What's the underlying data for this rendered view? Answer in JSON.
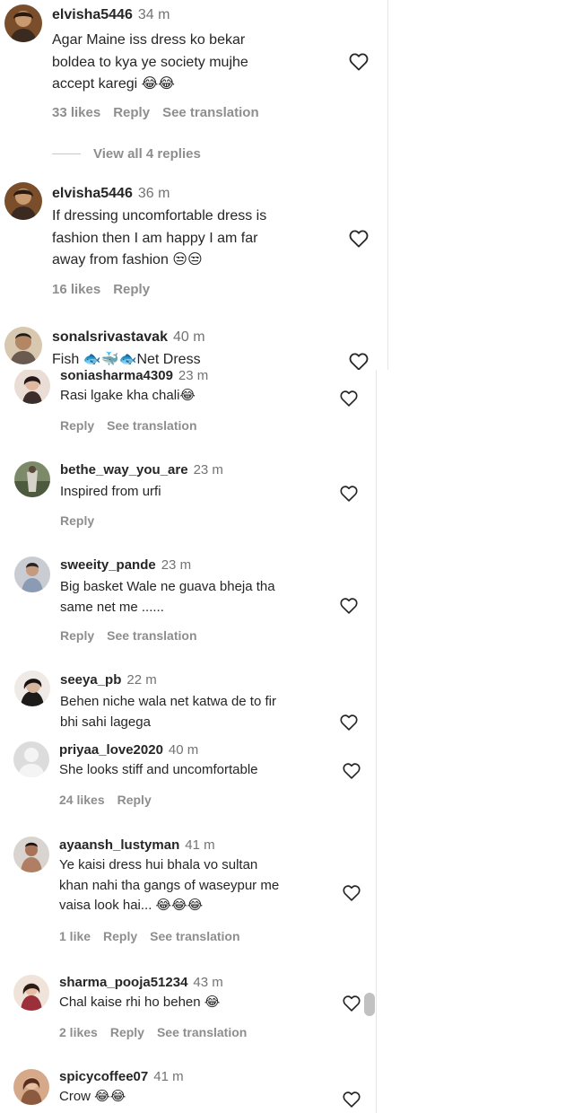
{
  "panel_a": {
    "comments": [
      {
        "username": "elvisha5446",
        "time": "34 m",
        "lines": [
          "Agar Maine iss dress ko bekar",
          "boldea to kya ye society mujhe",
          "accept karegi 😂😂"
        ],
        "likes": "33 likes",
        "reply": "Reply",
        "see_translation": "See translation"
      },
      {
        "username": "elvisha5446",
        "time": "36 m",
        "lines": [
          "If dressing uncomfortable dress is",
          "fashion then I am happy I am far",
          "away from fashion 😒😒"
        ],
        "likes": "16 likes",
        "reply": "Reply"
      },
      {
        "username": "sonalsrivastavak",
        "time": "40 m",
        "lines": [
          "Fish 🐟🐳🐟Net Dress"
        ]
      }
    ],
    "view_replies": "View all 4 replies"
  },
  "panel_b": {
    "comments": [
      {
        "username": "soniasharma4309",
        "time": "23 m",
        "lines": [
          "Rasi lgake kha chali😂"
        ],
        "reply": "Reply",
        "see_translation": "See translation"
      },
      {
        "username": "bethe_way_you_are",
        "time": "23 m",
        "lines": [
          "Inspired from urfi"
        ],
        "reply": "Reply"
      },
      {
        "username": "sweeity_pande",
        "time": "23 m",
        "lines": [
          "Big basket Wale ne guava bheja tha",
          "same net me ......"
        ],
        "reply": "Reply",
        "see_translation": "See translation"
      },
      {
        "username": "seeya_pb",
        "time": "22 m",
        "lines": [
          "Behen niche wala net katwa de to fir",
          "bhi sahi lagega"
        ]
      }
    ]
  },
  "panel_c": {
    "comments": [
      {
        "username": "priyaa_love2020",
        "time": "40 m",
        "lines": [
          "She looks stiff and uncomfortable"
        ],
        "likes": "24 likes",
        "reply": "Reply"
      },
      {
        "username": "ayaansh_lustyman",
        "time": "41 m",
        "lines": [
          "Ye kaisi dress hui bhala vo sultan",
          "khan nahi tha gangs of waseypur me",
          "vaisa look hai... 😂😂😂"
        ],
        "likes": "1 like",
        "reply": "Reply",
        "see_translation": "See translation"
      },
      {
        "username": "sharma_pooja51234",
        "time": "43 m",
        "lines": [
          "Chal kaise rhi ho behen 😂"
        ],
        "likes": "2 likes",
        "reply": "Reply",
        "see_translation": "See translation"
      },
      {
        "username": "spicycoffee07",
        "time": "41 m",
        "lines": [
          "Crow 😂😂"
        ]
      }
    ]
  },
  "icons": {
    "like": "heart-outline-icon",
    "avatar_placeholder": "person-silhouette-icon"
  },
  "colors": {
    "username": "#262626",
    "secondary": "#8e8e8e",
    "timestamp": "#737373",
    "background": "#ffffff"
  }
}
